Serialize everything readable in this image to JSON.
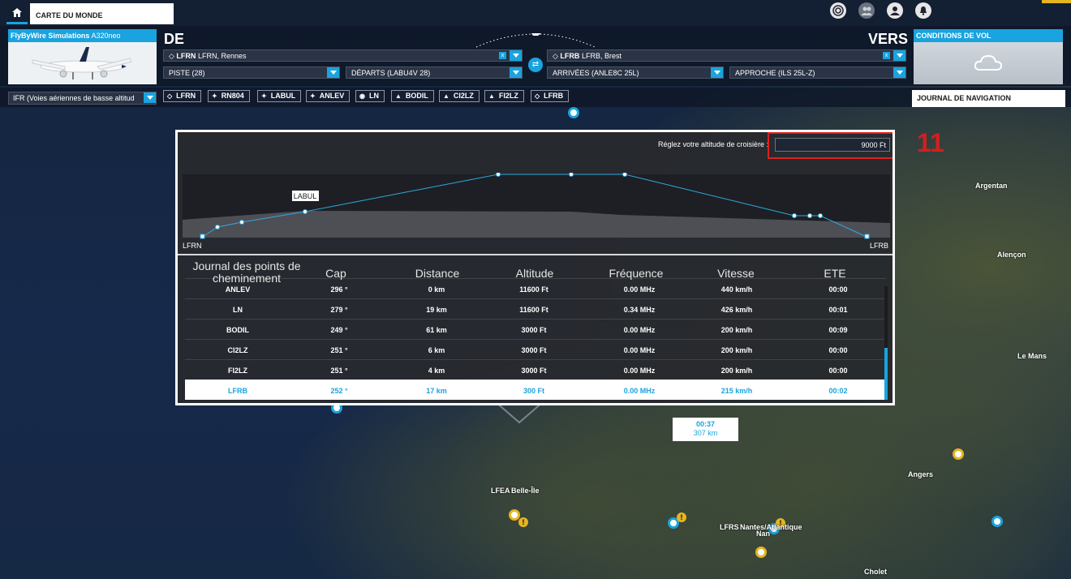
{
  "topbar": {
    "tab_label": "CARTE DU MONDE",
    "icons": [
      "home-icon",
      "activity-icon",
      "friends-icon",
      "profile-icon",
      "notification-icon"
    ]
  },
  "aircraft": {
    "maker": "FlyByWire Simulations",
    "model": "A320neo"
  },
  "from": {
    "label": "DE",
    "icao": "LFRN",
    "name": "LFRN, Rennes",
    "runway": "PISTE (28)",
    "departure": "DÉPARTS (LABU4V 28)"
  },
  "to": {
    "label": "VERS",
    "icao": "LFRB",
    "name": "LFRB, Brest",
    "arrival": "ARRIVÉES (ANLE8C 25L)",
    "approach": "APPROCHE (ILS 25L-Z)"
  },
  "conditions": {
    "title": "CONDITIONS DE VOL",
    "icon": "cloud-icon"
  },
  "route_type": "IFR (Voies aériennes de basse altitud",
  "waypoint_chips": [
    {
      "label": "LFRN",
      "icon": "airport-diamond-icon"
    },
    {
      "label": "RN804",
      "icon": "waypoint-star-icon"
    },
    {
      "label": "LABUL",
      "icon": "waypoint-star-icon"
    },
    {
      "label": "ANLEV",
      "icon": "waypoint-star-icon"
    },
    {
      "label": "LN",
      "icon": "vor-icon"
    },
    {
      "label": "BODIL",
      "icon": "triangle-icon"
    },
    {
      "label": "CI2LZ",
      "icon": "triangle-icon"
    },
    {
      "label": "FI2LZ",
      "icon": "triangle-icon"
    },
    {
      "label": "LFRB",
      "icon": "airport-diamond-icon"
    }
  ],
  "journal_button": "JOURNAL DE NAVIGATION",
  "navlog": {
    "altitude_label": "Réglez votre altitude de croisière :",
    "altitude_value": "9000 Ft",
    "profile": {
      "start_label": "LFRN",
      "end_label": "LFRB",
      "tooltip": "LABUL"
    },
    "headers": {
      "waypoint": "Journal des points de cheminement",
      "cap": "Cap",
      "distance": "Distance",
      "altitude": "Altitude",
      "frequency": "Fréquence",
      "speed": "Vitesse",
      "ete": "ETE"
    },
    "rows": [
      {
        "wp": "ANLEV",
        "cap": "296 °",
        "dist": "0 km",
        "alt": "11600 Ft",
        "freq": "0.00 MHz",
        "speed": "440 km/h",
        "ete": "00:00"
      },
      {
        "wp": "LN",
        "cap": "279 °",
        "dist": "19 km",
        "alt": "11600 Ft",
        "freq": "0.34 MHz",
        "speed": "426 km/h",
        "ete": "00:01"
      },
      {
        "wp": "BODIL",
        "cap": "249 °",
        "dist": "61 km",
        "alt": "3000 Ft",
        "freq": "0.00 MHz",
        "speed": "200 km/h",
        "ete": "00:09"
      },
      {
        "wp": "CI2LZ",
        "cap": "251 °",
        "dist": "6 km",
        "alt": "3000 Ft",
        "freq": "0.00 MHz",
        "speed": "200 km/h",
        "ete": "00:00"
      },
      {
        "wp": "FI2LZ",
        "cap": "251 °",
        "dist": "4 km",
        "alt": "3000 Ft",
        "freq": "0.00 MHz",
        "speed": "200 km/h",
        "ete": "00:00"
      },
      {
        "wp": "LFRB",
        "cap": "252 °",
        "dist": "17 km",
        "alt": "300 Ft",
        "freq": "0.00 MHz",
        "speed": "215 km/h",
        "ete": "00:02"
      }
    ]
  },
  "annotation_number": "11",
  "map": {
    "cities": [
      "Argentan",
      "Alençon",
      "Le Mans",
      "Angers",
      "Cholet",
      "Belle-Île",
      "Nantes/Atlantique",
      "Nan"
    ],
    "airports": [
      "LFEA",
      "LFRS"
    ],
    "route_summary": {
      "time": "00:37",
      "distance": "307 km"
    }
  }
}
